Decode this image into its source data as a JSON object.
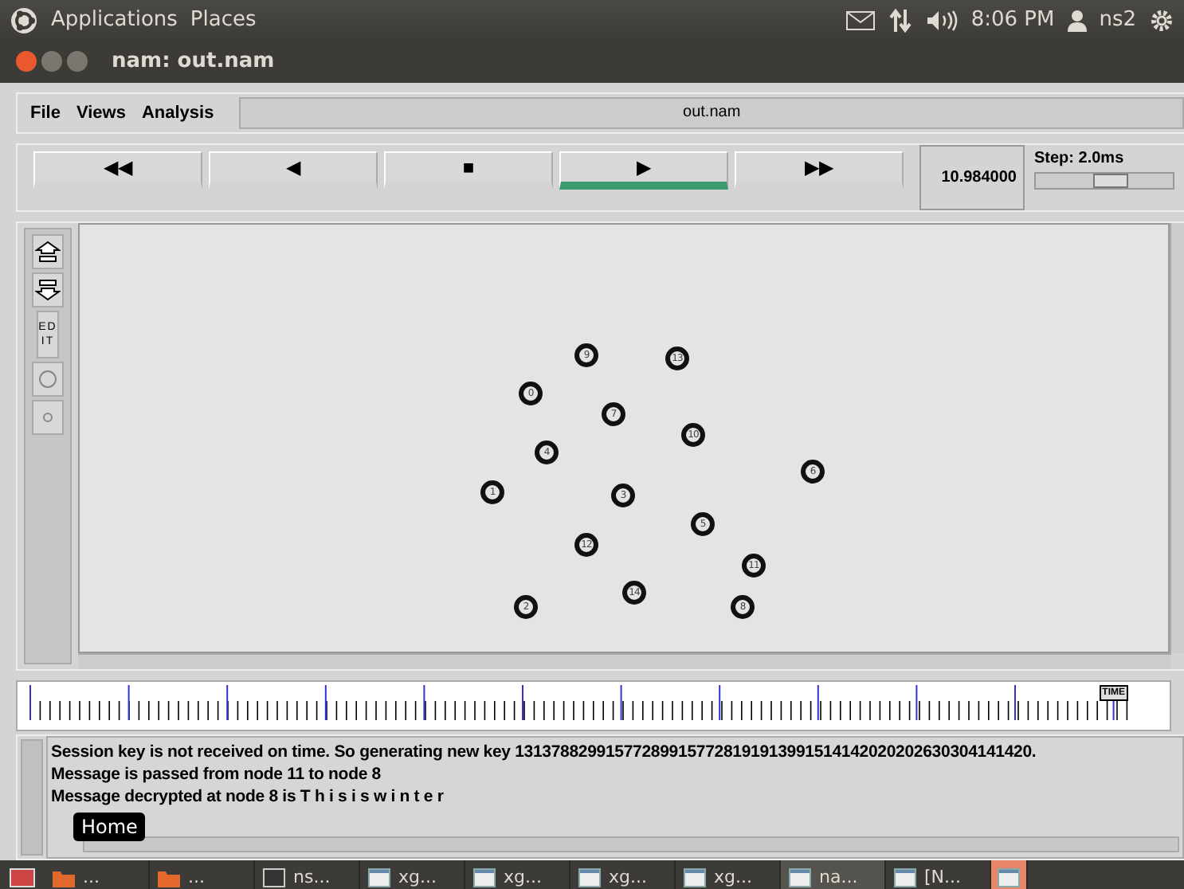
{
  "top_panel": {
    "menus": [
      "Applications",
      "Places"
    ],
    "clock": "8:06 PM",
    "user": "ns2"
  },
  "window": {
    "title": "nam: out.nam"
  },
  "menu_bar": {
    "items": [
      "File",
      "Views",
      "Analysis"
    ],
    "file_name": "out.nam"
  },
  "toolbar": {
    "buttons": [
      {
        "glyph": "◀◀",
        "selected": false
      },
      {
        "glyph": "◀",
        "selected": false
      },
      {
        "glyph": "■",
        "selected": false
      },
      {
        "glyph": "▶",
        "selected": true
      },
      {
        "glyph": "▶▶",
        "selected": false
      }
    ],
    "time": "10.984000",
    "step": {
      "label": "Step: 2.0ms",
      "level": 0.55
    }
  },
  "tools": [
    {
      "kind": "zoom-in"
    },
    {
      "kind": "zoom-out"
    },
    {
      "kind": "edit",
      "label": "ED IT"
    },
    {
      "kind": "big-node"
    },
    {
      "kind": "small-node"
    }
  ],
  "nodes": [
    "9",
    "13",
    "0",
    "7",
    "10",
    "4",
    "6",
    "1",
    "3",
    "5",
    "12",
    "11",
    "14",
    "2",
    "8"
  ],
  "timeline": {
    "marker": "TIME"
  },
  "log": [
    "Session key is not received on time. So generating new key 131378829915772899157728191913991514142020202630304141420.",
    "Message is passed from node 11 to node 8",
    "Message decrypted at node 8 is T h i s i s w i n t e r"
  ],
  "tooltip": "Home",
  "taskbar": [
    {
      "kind": "folder",
      "label": "...",
      "selected": false
    },
    {
      "kind": "folder",
      "label": "...",
      "selected": false
    },
    {
      "kind": "terminal",
      "label": "ns...",
      "selected": false
    },
    {
      "kind": "window",
      "label": "xg...",
      "selected": false
    },
    {
      "kind": "window",
      "label": "xg...",
      "selected": false
    },
    {
      "kind": "window",
      "label": "xg...",
      "selected": false
    },
    {
      "kind": "window",
      "label": "xg...",
      "selected": false
    },
    {
      "kind": "window",
      "label": "na...",
      "selected": true
    },
    {
      "kind": "window",
      "label": "[N...",
      "selected": false
    },
    {
      "kind": "urgent",
      "selected": false
    }
  ]
}
